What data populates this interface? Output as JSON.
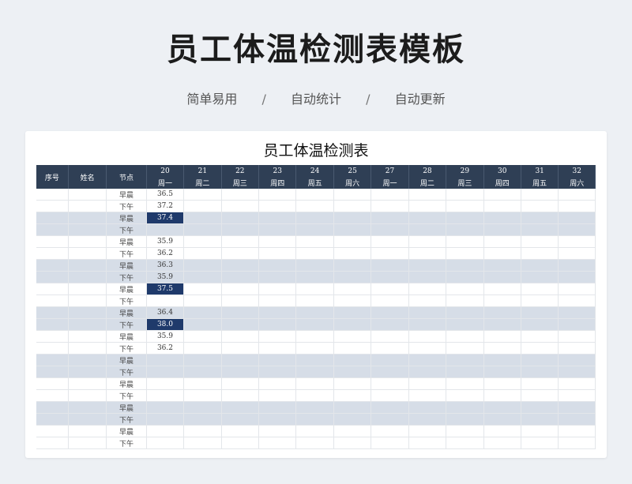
{
  "page": {
    "title": "员工体温检测表模板",
    "features": [
      "简单易用",
      "自动统计",
      "自动更新"
    ],
    "separator": "/"
  },
  "sheet": {
    "title": "员工体温检测表",
    "headers": {
      "index": "序号",
      "name": "姓名",
      "slot": "节点"
    },
    "days": [
      {
        "date": "20",
        "weekday": "周一"
      },
      {
        "date": "21",
        "weekday": "周二"
      },
      {
        "date": "22",
        "weekday": "周三"
      },
      {
        "date": "23",
        "weekday": "周四"
      },
      {
        "date": "24",
        "weekday": "周五"
      },
      {
        "date": "25",
        "weekday": "周六"
      },
      {
        "date": "27",
        "weekday": "周一"
      },
      {
        "date": "28",
        "weekday": "周二"
      },
      {
        "date": "29",
        "weekday": "周三"
      },
      {
        "date": "30",
        "weekday": "周四"
      },
      {
        "date": "31",
        "weekday": "周五"
      },
      {
        "date": "32",
        "weekday": "周六"
      }
    ],
    "rows": [
      {
        "slot": "早晨",
        "temp": "36.5",
        "flag": false
      },
      {
        "slot": "下午",
        "temp": "37.2",
        "flag": false
      },
      {
        "slot": "早晨",
        "temp": "37.4",
        "flag": true
      },
      {
        "slot": "下午",
        "temp": "",
        "flag": false
      },
      {
        "slot": "早晨",
        "temp": "35.9",
        "flag": false
      },
      {
        "slot": "下午",
        "temp": "36.2",
        "flag": false
      },
      {
        "slot": "早晨",
        "temp": "36.3",
        "flag": false
      },
      {
        "slot": "下午",
        "temp": "35.9",
        "flag": false
      },
      {
        "slot": "早晨",
        "temp": "37.5",
        "flag": true
      },
      {
        "slot": "下午",
        "temp": "",
        "flag": false
      },
      {
        "slot": "早晨",
        "temp": "36.4",
        "flag": false
      },
      {
        "slot": "下午",
        "temp": "38.0",
        "flag": true
      },
      {
        "slot": "早晨",
        "temp": "35.9",
        "flag": false
      },
      {
        "slot": "下午",
        "temp": "36.2",
        "flag": false
      },
      {
        "slot": "早晨",
        "temp": "",
        "flag": false
      },
      {
        "slot": "下午",
        "temp": "",
        "flag": false
      },
      {
        "slot": "早晨",
        "temp": "",
        "flag": false
      },
      {
        "slot": "下午",
        "temp": "",
        "flag": false
      },
      {
        "slot": "早晨",
        "temp": "",
        "flag": false
      },
      {
        "slot": "下午",
        "temp": "",
        "flag": false
      },
      {
        "slot": "早晨",
        "temp": "",
        "flag": false
      },
      {
        "slot": "下午",
        "temp": "",
        "flag": false
      }
    ]
  },
  "colors": {
    "header": "#2f3f55",
    "highlight": "#1f3a6b",
    "band": "#d6dde7"
  }
}
